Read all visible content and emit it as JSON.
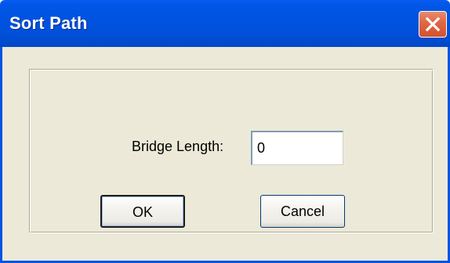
{
  "window": {
    "title": "Sort Path"
  },
  "form": {
    "bridge_length_label": "Bridge Length:",
    "bridge_length_value": "0"
  },
  "buttons": {
    "ok_label": "OK",
    "cancel_label": "Cancel"
  },
  "icons": {
    "close": "close-icon"
  },
  "colors": {
    "titlebar": "#0054e3",
    "dialog_face": "#ece9d8",
    "close_button": "#e06a47"
  }
}
